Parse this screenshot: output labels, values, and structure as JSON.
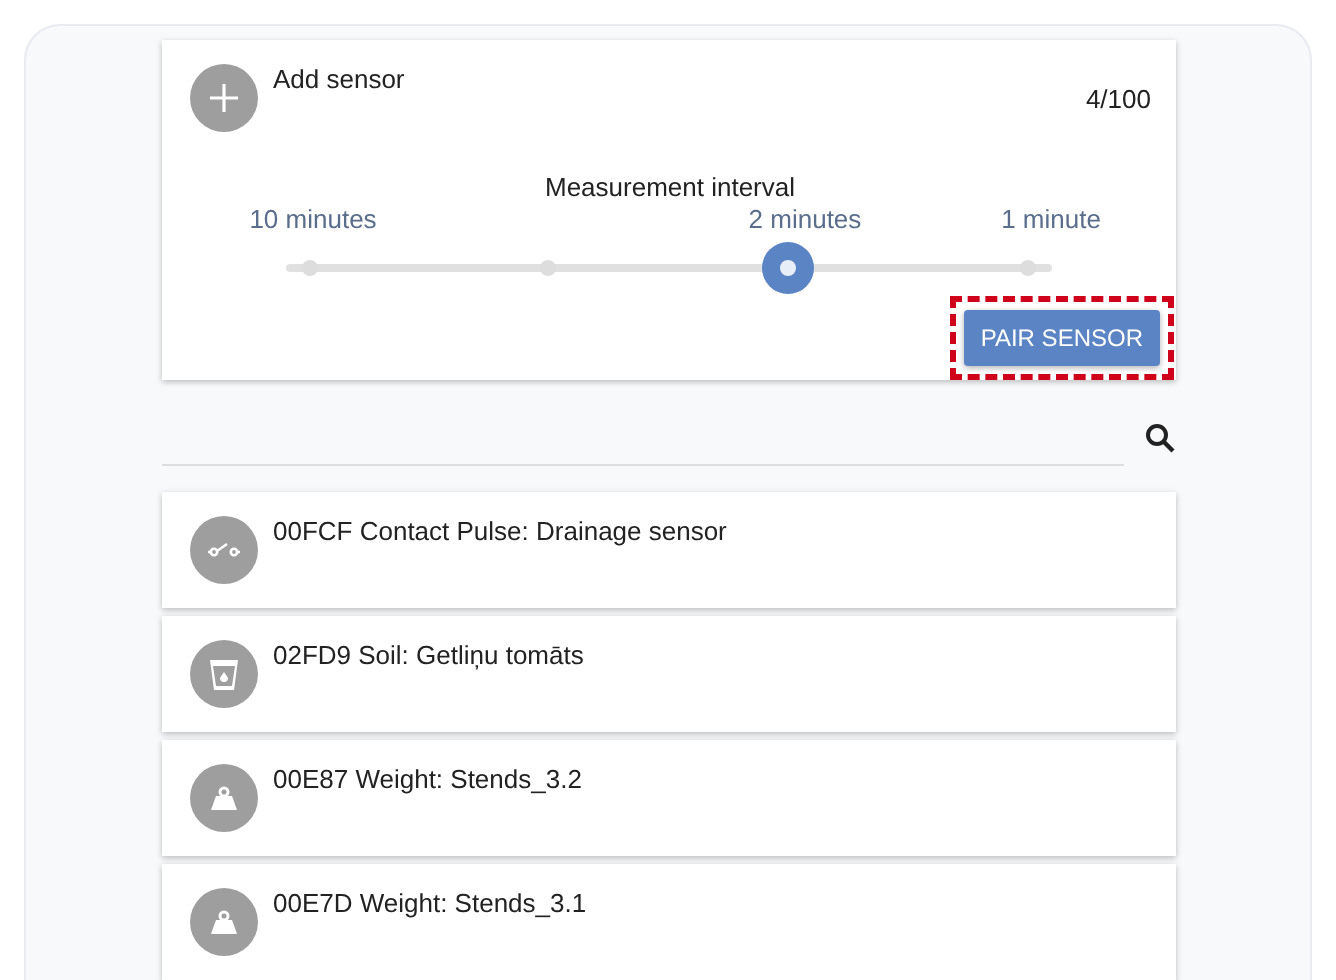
{
  "add_card": {
    "title": "Add sensor",
    "count": "4/100",
    "interval": {
      "label": "Measurement interval",
      "stops": [
        {
          "label": "10 minutes",
          "selected": false
        },
        {
          "selected": false
        },
        {
          "label": "2 minutes",
          "selected": true
        },
        {
          "label": "1 minute",
          "selected": false
        }
      ]
    },
    "button": {
      "label": "PAIR SENSOR",
      "highlighted": true
    }
  },
  "sensors": [
    {
      "kind": "contact",
      "label": "00FCF Contact Pulse: Drainage sensor"
    },
    {
      "kind": "soil",
      "label": "02FD9 Soil: Getliņu tomāts"
    },
    {
      "kind": "weight",
      "label": "00E87 Weight: Stends_3.2"
    },
    {
      "kind": "weight",
      "label": "00E7D Weight: Stends_3.1"
    }
  ]
}
